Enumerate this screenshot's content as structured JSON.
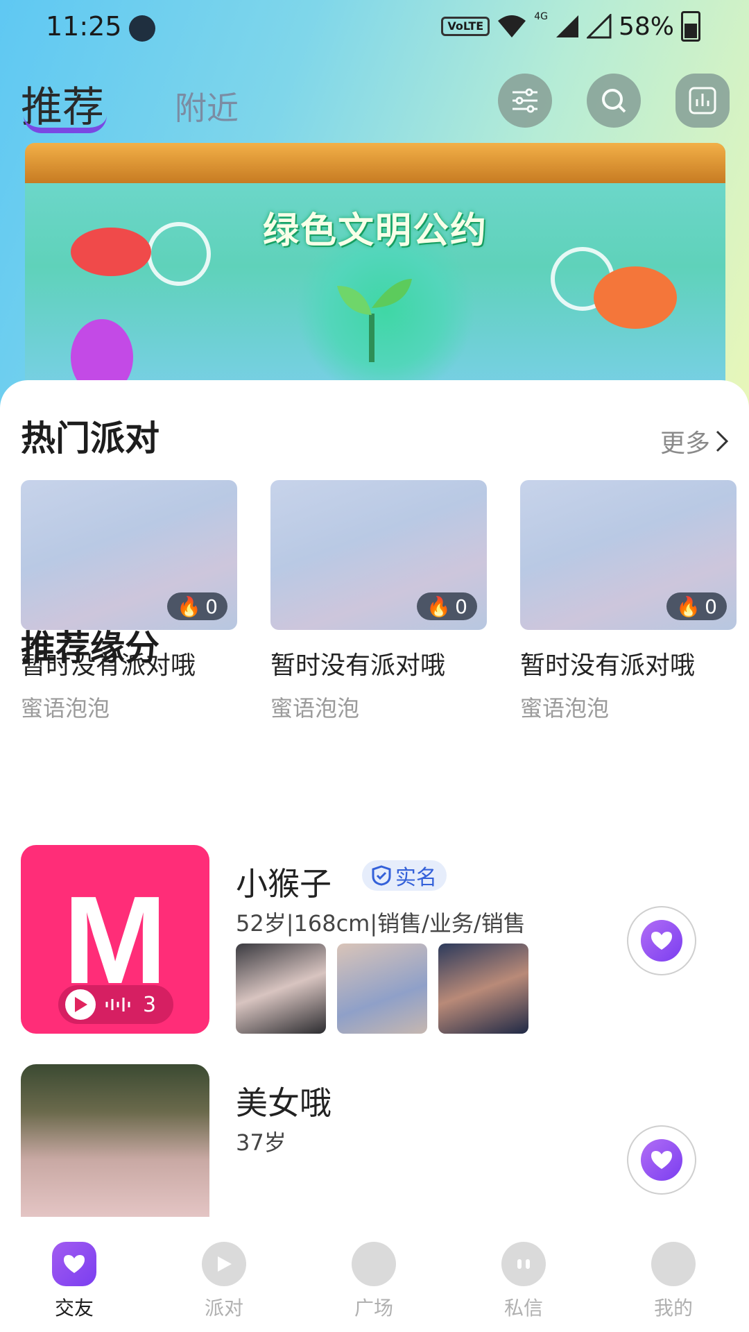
{
  "status_bar": {
    "time": "11:25",
    "network": "4G",
    "battery": "58%"
  },
  "top_nav": {
    "tabs": [
      {
        "label": "推荐",
        "active": true
      },
      {
        "label": "附近",
        "active": false
      }
    ]
  },
  "banner": {
    "title": "绿色文明公约"
  },
  "hot_party": {
    "title": "热门派对",
    "more": "更多",
    "items": [
      {
        "heat": "0",
        "name": "暂时没有派对哦",
        "subtitle": "蜜语泡泡"
      },
      {
        "heat": "0",
        "name": "暂时没有派对哦",
        "subtitle": "蜜语泡泡"
      },
      {
        "heat": "0",
        "name": "暂时没有派对哦",
        "subtitle": "蜜语泡泡"
      }
    ]
  },
  "recommend": {
    "title": "推荐缘分",
    "users": [
      {
        "name": "小猴子",
        "badge": "实名",
        "info": "52岁|168cm|销售/业务/销售",
        "voice_count": "3",
        "avatar_letter": "M"
      },
      {
        "name": "美女哦",
        "info": "37岁"
      }
    ]
  },
  "bottom_nav": {
    "tabs": [
      {
        "label": "交友",
        "active": true
      },
      {
        "label": "派对",
        "active": false
      },
      {
        "label": "广场",
        "active": false
      },
      {
        "label": "私信",
        "active": false
      },
      {
        "label": "我的",
        "active": false
      }
    ]
  },
  "colors": {
    "accent": "#7b3ef0",
    "brand_pink": "#ff2d78",
    "badge_blue": "#3461d9"
  }
}
